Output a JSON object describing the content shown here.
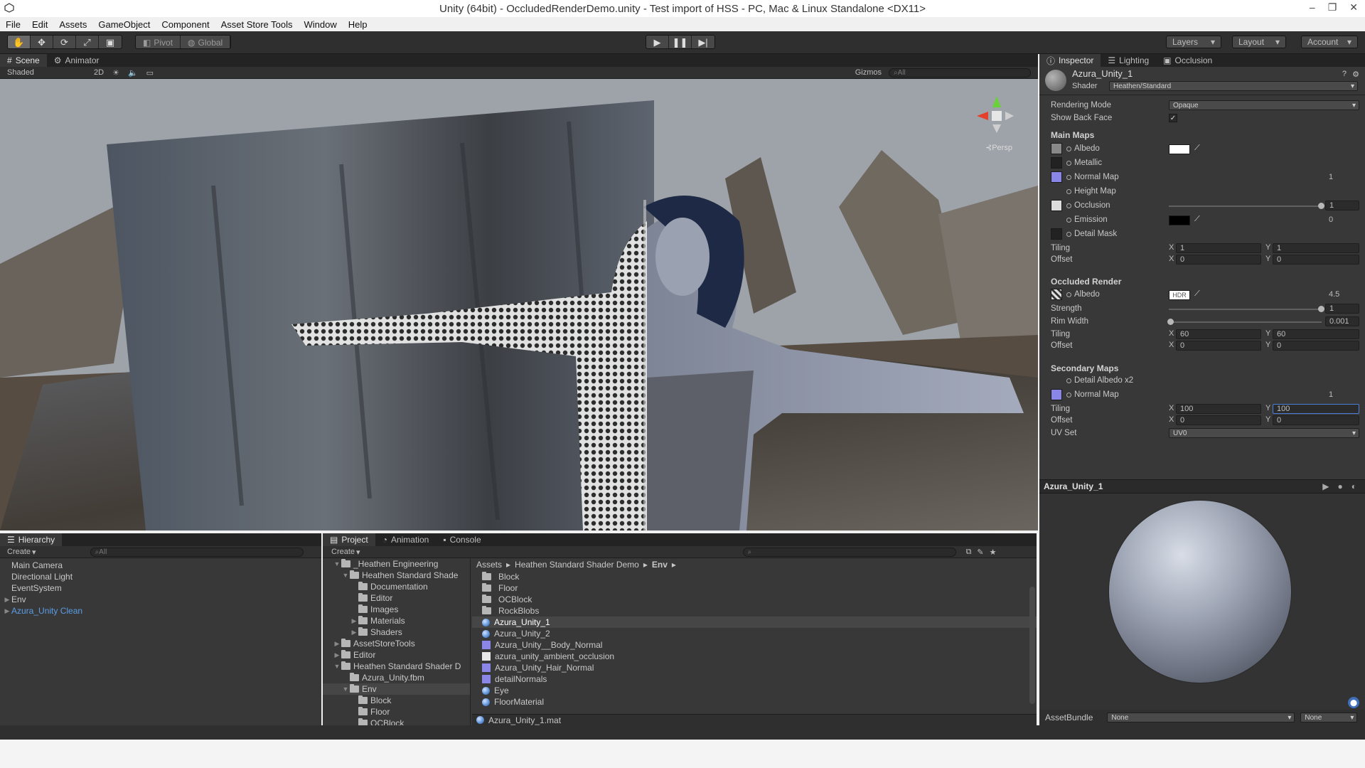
{
  "window": {
    "title": "Unity (64bit) - OccludedRenderDemo.unity - Test import of HSS - PC, Mac & Linux Standalone <DX11>",
    "controls": [
      "–",
      "❐",
      "✕"
    ]
  },
  "menu": [
    "File",
    "Edit",
    "Assets",
    "GameObject",
    "Component",
    "Asset Store Tools",
    "Window",
    "Help"
  ],
  "toolbar": {
    "pivot": "Pivot",
    "global": "Global",
    "layers": "Layers",
    "layout": "Layout",
    "account": "Account"
  },
  "scene": {
    "tabs": [
      "Scene",
      "Animator"
    ],
    "shading": "Shaded",
    "mode_2d": "2D",
    "gizmos": "Gizmos",
    "search_placeholder": "All",
    "persp_label": "Persp"
  },
  "hierarchy": {
    "tab": "Hierarchy",
    "create": "Create",
    "search_placeholder": "All",
    "items": [
      {
        "label": "Main Camera"
      },
      {
        "label": "Directional Light"
      },
      {
        "label": "EventSystem"
      },
      {
        "label": "Env"
      },
      {
        "label": "Azura_Unity Clean"
      }
    ]
  },
  "project": {
    "tabs": [
      "Project",
      "Animation",
      "Console"
    ],
    "create": "Create",
    "tree": [
      {
        "label": "_Heathen Engineering"
      },
      {
        "label": "Heathen Standard Shade"
      },
      {
        "label": "Documentation"
      },
      {
        "label": "Editor"
      },
      {
        "label": "Images"
      },
      {
        "label": "Materials"
      },
      {
        "label": "Shaders"
      },
      {
        "label": "AssetStoreTools"
      },
      {
        "label": "Editor"
      },
      {
        "label": "Heathen Standard Shader D"
      },
      {
        "label": "Azura_Unity.fbm"
      },
      {
        "label": "Env"
      },
      {
        "label": "Block"
      },
      {
        "label": "Floor"
      },
      {
        "label": "OCBlock"
      }
    ],
    "breadcrumb": [
      "Assets",
      "Heathen Standard Shader Demo",
      "Env"
    ],
    "files": [
      {
        "label": "Block",
        "kind": "folder"
      },
      {
        "label": "Floor",
        "kind": "folder"
      },
      {
        "label": "OCBlock",
        "kind": "folder"
      },
      {
        "label": "RockBlobs",
        "kind": "folder"
      },
      {
        "label": "Azura_Unity_1",
        "kind": "material"
      },
      {
        "label": "Azura_Unity_2",
        "kind": "material"
      },
      {
        "label": "Azura_Unity__Body_Normal",
        "kind": "normal"
      },
      {
        "label": "azura_unity_ambient_occlusion",
        "kind": "texture"
      },
      {
        "label": "Azura_Unity_Hair_Normal",
        "kind": "normal"
      },
      {
        "label": "detailNormals",
        "kind": "normal"
      },
      {
        "label": "Eye",
        "kind": "material"
      },
      {
        "label": "FloorMaterial",
        "kind": "material"
      }
    ],
    "footer": "Azura_Unity_1.mat"
  },
  "inspector": {
    "tabs": [
      "Inspector",
      "Lighting",
      "Occlusion"
    ],
    "object_name": "Azura_Unity_1",
    "shader_label": "Shader",
    "shader_value": "Heathen/Standard",
    "rendering_mode_label": "Rendering Mode",
    "rendering_mode_value": "Opaque",
    "show_back_face": "Show Back Face",
    "main_maps": "Main Maps",
    "albedo": "Albedo",
    "metallic": "Metallic",
    "normal_map": "Normal Map",
    "normal_map_value": "1",
    "height_map": "Height Map",
    "occlusion": "Occlusion",
    "occlusion_value": "1",
    "emission": "Emission",
    "emission_value": "0",
    "detail_mask": "Detail Mask",
    "tiling": "Tiling",
    "offset": "Offset",
    "main_tiling_x": "1",
    "main_tiling_y": "1",
    "main_offset_x": "0",
    "main_offset_y": "0",
    "occluded_render": "Occluded Render",
    "oc_albedo": "Albedo",
    "hdr": "HDR",
    "oc_albedo_value": "4.5",
    "strength": "Strength",
    "strength_value": "1",
    "rim_width": "Rim Width",
    "rim_width_value": "0.001",
    "oc_tiling_x": "60",
    "oc_tiling_y": "60",
    "oc_offset_x": "0",
    "oc_offset_y": "0",
    "secondary_maps": "Secondary Maps",
    "detail_albedo": "Detail Albedo x2",
    "sec_normal_map": "Normal Map",
    "sec_normal_value": "1",
    "sec_tiling_x": "100",
    "sec_tiling_y": "100",
    "sec_offset_x": "0",
    "sec_offset_y": "0",
    "uv_set": "UV Set",
    "uv_set_value": "UV0",
    "x": "X",
    "y": "Y",
    "preview_title": "Azura_Unity_1",
    "assetbundle_label": "AssetBundle",
    "assetbundle_value": "None",
    "assetbundle_variant": "None"
  },
  "colors": {
    "accent": "#3e5f96",
    "panel": "#383838",
    "selected_hierarchy_text": "#5a9ee8"
  }
}
